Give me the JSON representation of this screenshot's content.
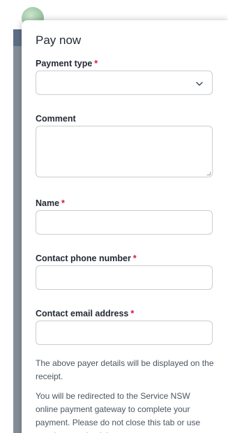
{
  "modal": {
    "title": "Pay now",
    "fields": {
      "payment_type": {
        "label": "Payment type",
        "required_mark": "*",
        "value": ""
      },
      "comment": {
        "label": "Comment",
        "value": ""
      },
      "name": {
        "label": "Name",
        "required_mark": "*",
        "value": ""
      },
      "phone": {
        "label": "Contact phone number",
        "required_mark": "*",
        "value": ""
      },
      "email": {
        "label": "Contact email address",
        "required_mark": "*",
        "value": ""
      }
    },
    "notes": {
      "payer_details": "The above payer details will be displayed on the receipt.",
      "redirect": "You will be redirected to the Service NSW online payment gateway to complete your payment. Please do not close this tab or use your browser back button."
    }
  },
  "colors": {
    "required": "#d7153a",
    "text": "#242934",
    "border": "#c9cdd3",
    "overlay": "#868e99",
    "header_band": "#5e6f86"
  },
  "icons": {
    "dropdown": "chevron-down-icon",
    "logo": "logo-icon"
  }
}
